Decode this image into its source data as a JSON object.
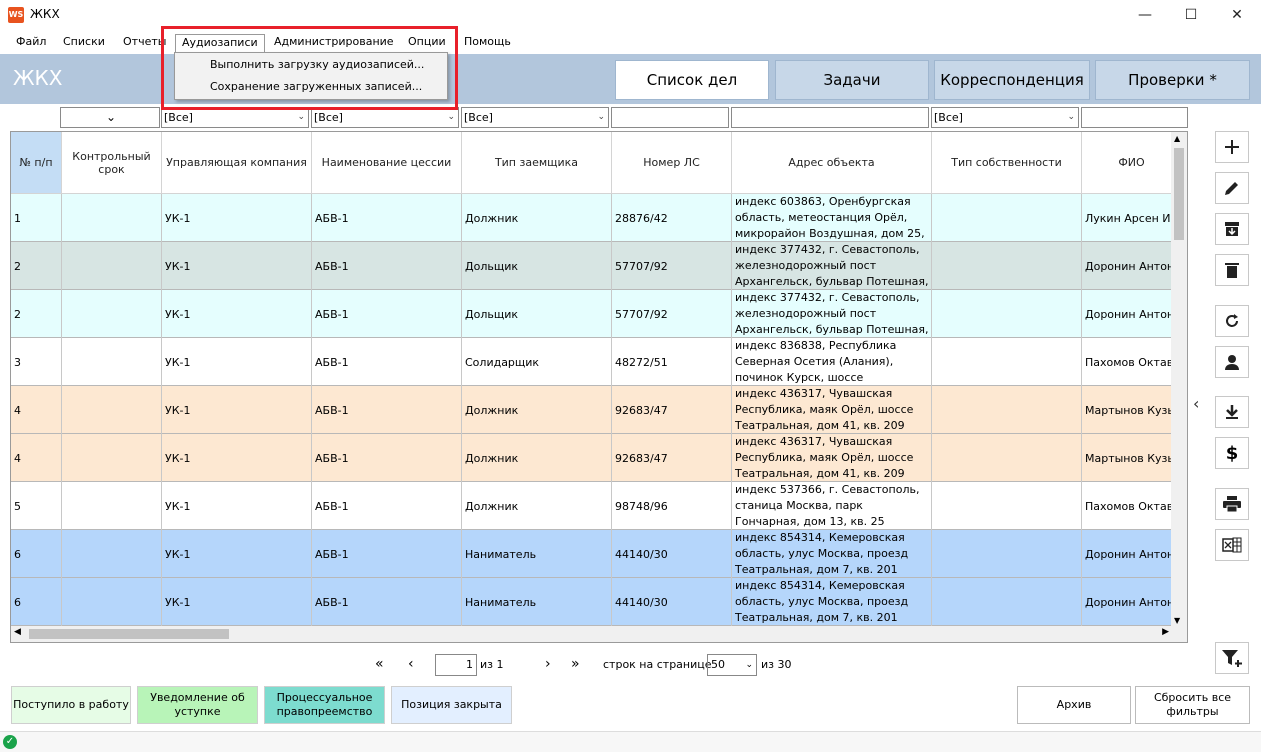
{
  "window": {
    "title": "ЖКХ",
    "app_icon": "WS"
  },
  "menu": [
    "Файл",
    "Списки",
    "Отчеты",
    "Аудиозаписи",
    "Администрирование",
    "Опции",
    "Помощь"
  ],
  "dropdown": [
    "Выполнить загрузку аудиозаписей...",
    "Сохранение загруженных записей..."
  ],
  "header": {
    "title": "ЖКХ",
    "tabs": [
      "Список дел",
      "Задачи",
      "Корреспонденция",
      "Проверки *"
    ]
  },
  "filters": {
    "all": "[Все]"
  },
  "columns": [
    "№ п/п",
    "Контрольный срок",
    "Управляющая компания",
    "Наименование цессии",
    "Тип заемщика",
    "Номер ЛС",
    "Адрес объекта",
    "Тип собственности",
    "ФИО"
  ],
  "rows": [
    {
      "n": "1",
      "uk": "УК-1",
      "ces": "АБВ-1",
      "type": "Должник",
      "ls": "28876/42",
      "addr": "индекс 603863, Оренбургская область, метеостанция Орёл, микрорайон Воздушная, дом 25, к",
      "fio": "Лукин Арсен Из",
      "color": "#e5fefe"
    },
    {
      "n": "2",
      "uk": "УК-1",
      "ces": "АБВ-1",
      "type": "Дольщик",
      "ls": "57707/92",
      "addr": "индекс 377432, г. Севастополь, железнодорожный пост Архангельск, бульвар Потешная, д",
      "fio": "Доронин Антон",
      "color": "#d7e5e3"
    },
    {
      "n": "2",
      "uk": "УК-1",
      "ces": "АБВ-1",
      "type": "Дольщик",
      "ls": "57707/92",
      "addr": "индекс 377432, г. Севастополь, железнодорожный пост Архангельск, бульвар Потешная, д",
      "fio": "Доронин Антон",
      "color": "#e5fefe"
    },
    {
      "n": "3",
      "uk": "УК-1",
      "ces": "АБВ-1",
      "type": "Солидарщик",
      "ls": "48272/51",
      "addr": "индекс 836838, Республика Северная Осетия (Алания), починок Курск, шоссе Колобашки",
      "fio": "Пахомов Октави",
      "color": "#ffffff"
    },
    {
      "n": "4",
      "uk": "УК-1",
      "ces": "АБВ-1",
      "type": "Должник",
      "ls": "92683/47",
      "addr": "индекс 436317, Чувашская Республика, маяк Орёл, шоссе Театральная, дом 41, кв. 209",
      "fio": "Мартынов Кузь",
      "color": "#fde8d2"
    },
    {
      "n": "4",
      "uk": "УК-1",
      "ces": "АБВ-1",
      "type": "Должник",
      "ls": "92683/47",
      "addr": "индекс 436317, Чувашская Республика, маяк Орёл, шоссе Театральная, дом 41, кв. 209",
      "fio": "Мартынов Кузь",
      "color": "#fde8d2"
    },
    {
      "n": "5",
      "uk": "УК-1",
      "ces": "АБВ-1",
      "type": "Должник",
      "ls": "98748/96",
      "addr": "индекс 537366, г. Севастополь, станица Москва, парк Гончарная, дом 13, кв. 25",
      "fio": "Пахомов Октави",
      "color": "#ffffff"
    },
    {
      "n": "6",
      "uk": "УК-1",
      "ces": "АБВ-1",
      "type": "Наниматель",
      "ls": "44140/30",
      "addr": "индекс 854314, Кемеровская область, улус Москва, проезд Театральная, дом 7, кв. 201",
      "fio": "Доронин Антон",
      "color": "#b5d6fb"
    },
    {
      "n": "6",
      "uk": "УК-1",
      "ces": "АБВ-1",
      "type": "Наниматель",
      "ls": "44140/30",
      "addr": "индекс 854314, Кемеровская область, улус Москва, проезд Театральная, дом 7, кв. 201",
      "fio": "Доронин Антон",
      "color": "#b5d6fb"
    }
  ],
  "pager": {
    "page": "1",
    "of": "из 1",
    "rows_label": "строк на странице",
    "per_page": "50",
    "total": "из 30"
  },
  "bottom": {
    "b1": "Поступило в работу",
    "b2": "Уведомление об уступке",
    "b3": "Процессуальное правопреемство",
    "b4": "Позиция закрыта",
    "archive": "Архив",
    "reset": "Сбросить все фильтры"
  },
  "colors": {
    "header": "#b2c6dc",
    "highlight": "#e8202a",
    "b1": "#e6fce6",
    "b2": "#b8f4b8",
    "b3": "#7ddccf",
    "b4": "#e3efff"
  }
}
